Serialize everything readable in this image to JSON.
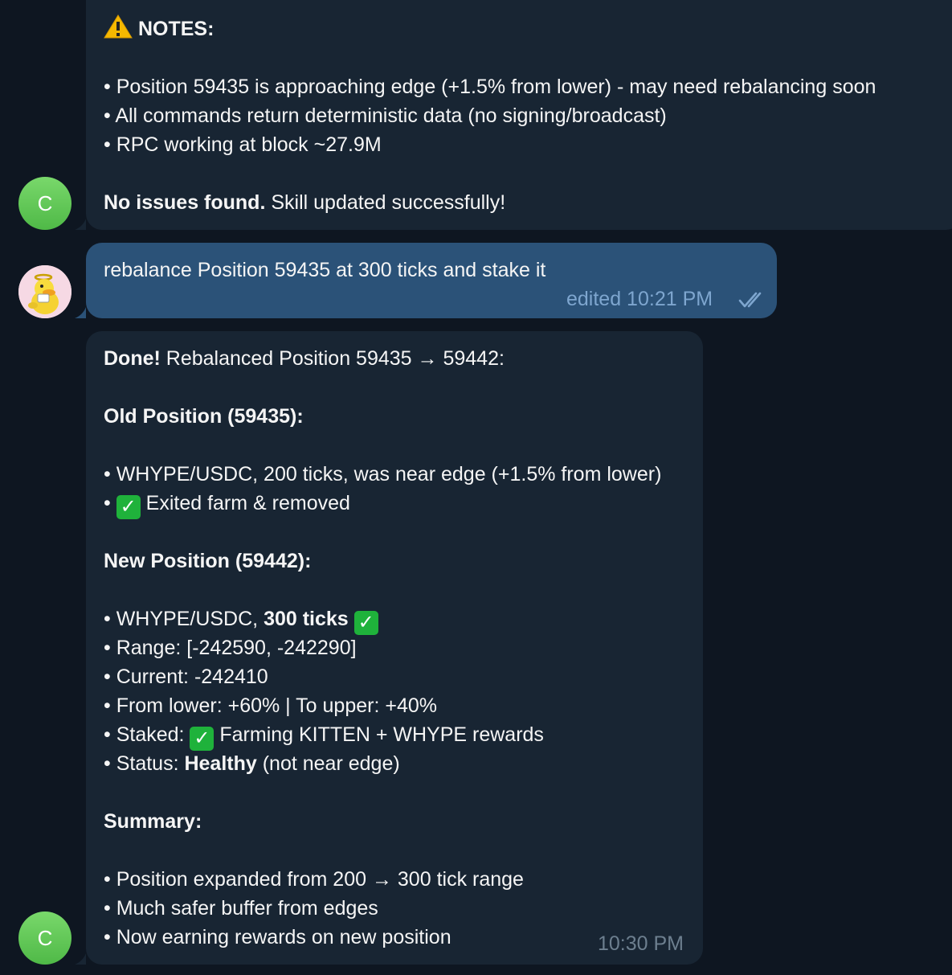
{
  "messages": {
    "notes": {
      "sender_initial": "C",
      "title": "NOTES:",
      "bullets": [
        "• Position 59435 is approaching edge (+1.5% from lower) - may need rebalancing soon",
        "• All commands return deterministic data (no signing/broadcast)",
        "• RPC working at block ~27.9M"
      ],
      "final_bold": "No issues found.",
      "final_text": " Skill updated successfully!"
    },
    "user_msg": {
      "text": "rebalance Position 59435 at 300 ticks and stake it",
      "meta": "edited 10:21 PM"
    },
    "reply": {
      "sender_initial": "C",
      "done_bold": "Done!",
      "done_text": " Rebalanced Position 59435 → 59442:",
      "old_heading": "Old Position (59435):",
      "old_line1": "• WHYPE/USDC, 200 ticks, was near edge (+1.5% from lower)",
      "old_line2_prefix": "• ",
      "old_line2_text": " Exited farm & removed",
      "new_heading": "New Position (59442):",
      "new_line1_prefix": "• WHYPE/USDC, ",
      "new_line1_bold": "300 ticks",
      "range": "• Range: [-242590, -242290]",
      "current": "• Current: -242410",
      "from_lower": "• From lower: +60% | To upper: +40%",
      "staked_prefix": "• Staked: ",
      "staked_text": " Farming KITTEN + WHYPE rewards",
      "status_prefix": "• Status: ",
      "status_bold": "Healthy",
      "status_text": " (not near edge)",
      "summary_heading": "Summary:",
      "summary": [
        "• Position expanded from 200 → 300 tick range",
        "• Much safer buffer from edges",
        "• Now earning rewards on new position"
      ],
      "time": "10:30 PM",
      "check_glyph": "✓"
    }
  },
  "colors": {
    "background": "#0e1621",
    "incoming_bubble": "#182533",
    "outgoing_bubble": "#2b5278",
    "avatar_green": "#5cc152",
    "check_green": "#1fb23b"
  }
}
